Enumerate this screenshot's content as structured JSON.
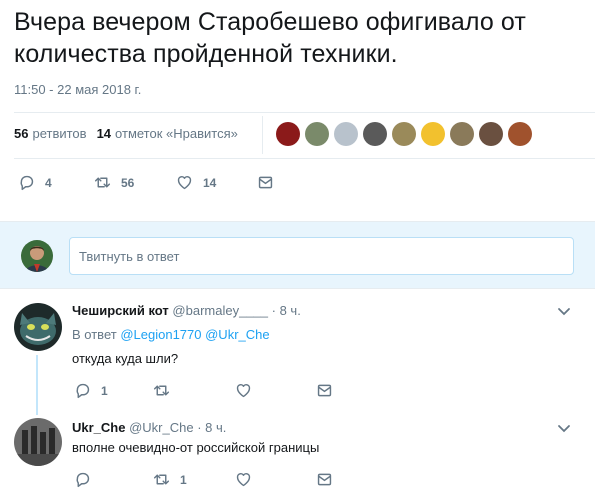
{
  "tweet": {
    "text": "Вчера вечером Старобешево офигивало от количества пройденной техники.",
    "timestamp": "11:50 - 22 мая 2018 г."
  },
  "stats": {
    "retweets_count": "56",
    "retweets_label": "ретвитов",
    "likes_count": "14",
    "likes_label": "отметок «Нравится»"
  },
  "likers": [
    {
      "name": "liker-1",
      "color": "#8b1a1a"
    },
    {
      "name": "liker-2",
      "color": "#7a8a6a"
    },
    {
      "name": "liker-3",
      "color": "#b8c2cc"
    },
    {
      "name": "liker-4",
      "color": "#5a5a5a"
    },
    {
      "name": "liker-5",
      "color": "#9a8a5a"
    },
    {
      "name": "liker-6",
      "color": "#f2c12e"
    },
    {
      "name": "liker-7",
      "color": "#8a7a5a"
    },
    {
      "name": "liker-8",
      "color": "#6a5040"
    },
    {
      "name": "liker-9",
      "color": "#a0522d"
    }
  ],
  "actions": {
    "replies": "4",
    "retweets": "56",
    "likes": "14"
  },
  "reply_box": {
    "placeholder": "Твитнуть в ответ"
  },
  "comments": [
    {
      "display_name": "Чеширский кот",
      "handle": "@barmaley____",
      "time": "· 8 ч.",
      "reply_prefix": "В ответ",
      "mention_1": "@Legion1770",
      "mention_2": "@Ukr_Che",
      "text": "откуда куда шли?",
      "reply_count": "1",
      "retweet_count": "",
      "like_count": ""
    },
    {
      "display_name": "Ukr_Che",
      "handle": "@Ukr_Che",
      "time": "· 8 ч.",
      "text": "вполне очевидно-от российской границы",
      "reply_count": "",
      "retweet_count": "1",
      "like_count": ""
    }
  ],
  "colors": {
    "accent": "#1da1f2",
    "muted": "#657786",
    "reply_bg": "#e8f5fd"
  }
}
